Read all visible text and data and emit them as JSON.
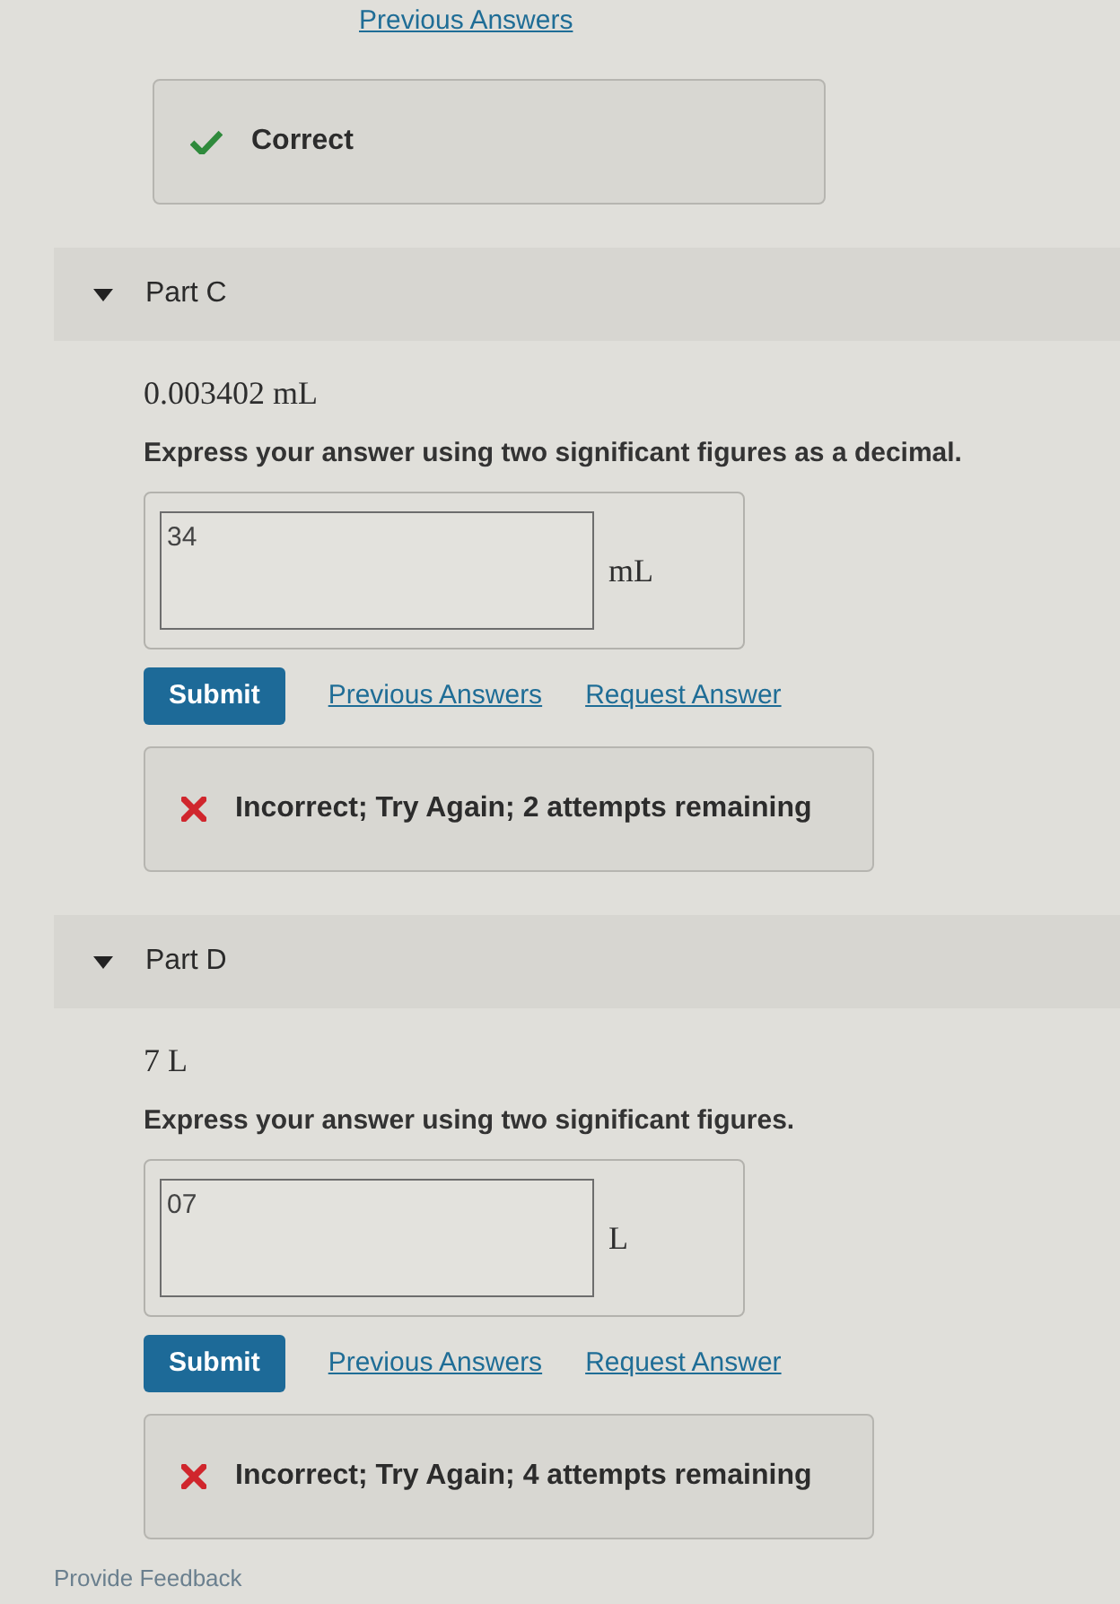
{
  "previous_answers_link": "Previous Answers",
  "previous_feedback": {
    "kind": "correct",
    "message": "Correct"
  },
  "parts": [
    {
      "title": "Part C",
      "expanded": true,
      "given": "0.003402 mL",
      "prompt": "Express your answer using two significant figures as a decimal.",
      "answer": {
        "value": "34",
        "unit": "mL"
      },
      "submit_button": "Submit",
      "previous_answers_link": "Previous Answers",
      "request_answer_link": "Request Answer",
      "feedback": {
        "kind": "incorrect",
        "message": "Incorrect; Try Again; 2 attempts remaining"
      }
    },
    {
      "title": "Part D",
      "expanded": true,
      "given": "7 L",
      "prompt": "Express your answer using two significant figures.",
      "answer": {
        "value": "07",
        "unit": "L"
      },
      "submit_button": "Submit",
      "previous_answers_link": "Previous Answers",
      "request_answer_link": "Request Answer",
      "feedback": {
        "kind": "incorrect",
        "message": "Incorrect; Try Again; 4 attempts remaining"
      }
    }
  ],
  "footer_link": "Provide Feedback"
}
